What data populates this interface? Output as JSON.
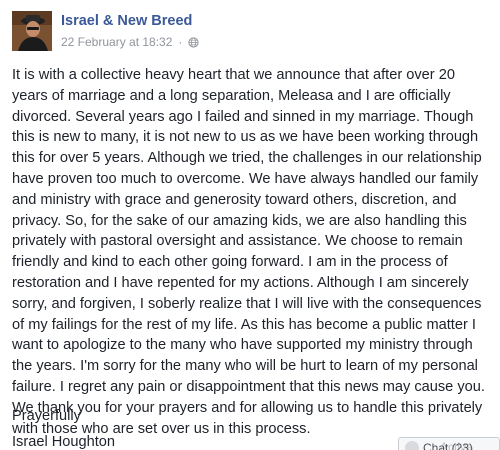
{
  "post": {
    "author": "Israel & New Breed",
    "timestamp": "22 February at 18:32",
    "separator": "·",
    "privacy_icon": "globe-icon",
    "body": "It is with a collective heavy heart that we announce that after over 20 years of marriage and a long separation, Meleasa and I are officially divorced. Several years ago I failed and sinned in my marriage. Though this is new to many, it is not new to us as we have been working through this for over 5 years. Although we tried, the challenges in our relationship have proven too much to overcome. We have always handled our family and ministry with grace and generosity toward others, discretion, and privacy. So, for the sake of our amazing kids, we are also handling this privately with pastoral oversight and assistance. We choose to remain friendly and kind to each other going forward. I am in the process of restoration and I have repented for my actions. Although I am sincerely sorry, and forgiven, I soberly realize that I will live with the consequences of my failings for the rest of my life. As this has become a public matter I want to apologize to the many who have supported my ministry through the years. I'm sorry for the many who will be hurt to learn of my personal failure. I regret any pain or disappointment that this news may cause you. We thank you for your prayers and for allowing us to handle this privately with those who are set over us in this process.",
    "closing": "Prayerfully",
    "signature": "Israel Houghton"
  },
  "chat": {
    "label": "Chat (23)"
  },
  "watermark": "Activa",
  "colors": {
    "author_link": "#3b5998",
    "meta_text": "#90949c",
    "body_text": "#1d2129"
  }
}
